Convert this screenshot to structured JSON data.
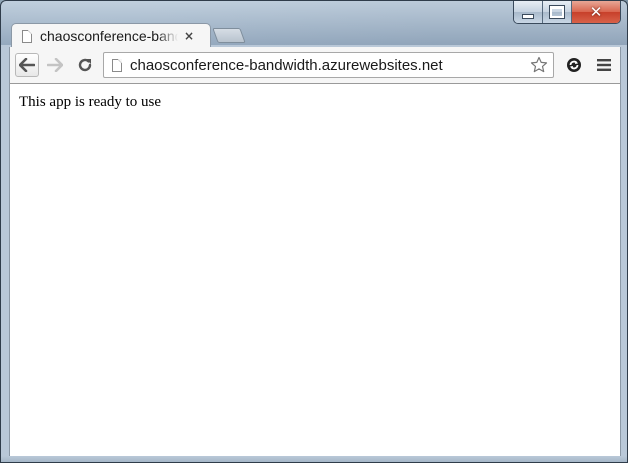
{
  "window": {
    "caption_buttons": {
      "minimize_icon": "minimize-icon",
      "maximize_icon": "maximize-icon",
      "close_glyph": "✕"
    }
  },
  "tabs": [
    {
      "title": "chaosconference-bandwidth.azurewebsites.net",
      "close_glyph": "×",
      "active": true
    }
  ],
  "toolbar": {
    "back_icon": "back-arrow-icon",
    "forward_icon": "forward-arrow-icon",
    "reload_icon": "reload-icon",
    "url": "chaosconference-bandwidth.azurewebsites.net",
    "bookmark_icon": "star-icon",
    "extension_icon": "extension-icon",
    "menu_icon": "hamburger-menu-icon"
  },
  "page": {
    "body_text": "This app is ready to use"
  },
  "colors": {
    "close_button": "#c7402a",
    "chrome_frame": "#b9c8d8",
    "tab_background": "#f6f6f6",
    "content_background": "#ffffff"
  }
}
